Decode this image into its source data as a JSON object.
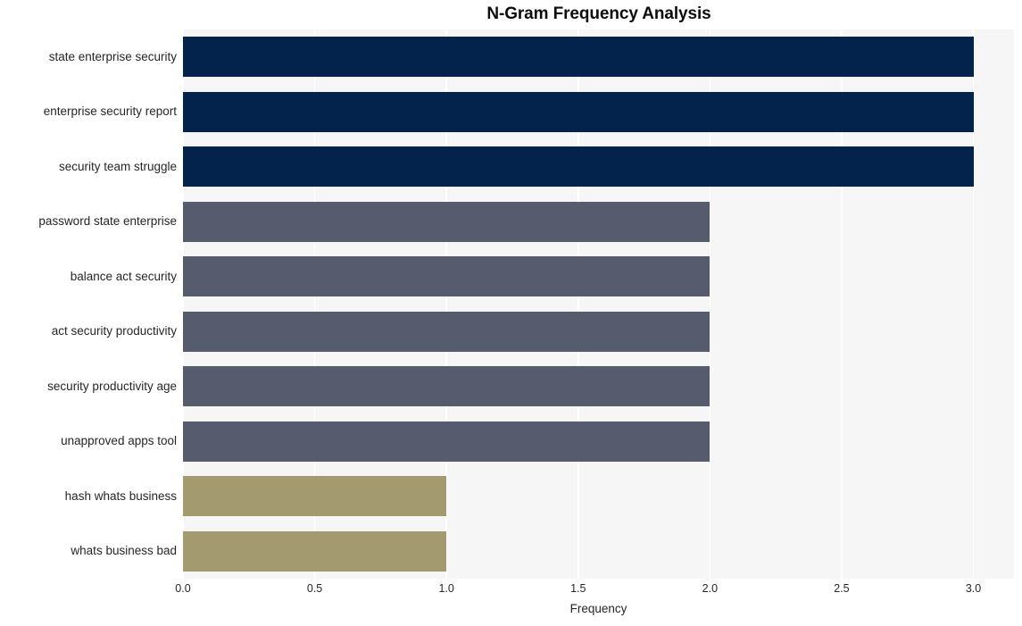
{
  "chart_data": {
    "type": "bar",
    "orientation": "horizontal",
    "title": "N-Gram Frequency Analysis",
    "xlabel": "Frequency",
    "ylabel": "",
    "categories": [
      "state enterprise security",
      "enterprise security report",
      "security team struggle",
      "password state enterprise",
      "balance act security",
      "act security productivity",
      "security productivity age",
      "unapproved apps tool",
      "hash whats business",
      "whats business bad"
    ],
    "values": [
      3,
      3,
      3,
      2,
      2,
      2,
      2,
      2,
      1,
      1
    ],
    "bar_colors": [
      "#03224c",
      "#03224c",
      "#03224c",
      "#565c6e",
      "#565c6e",
      "#565c6e",
      "#565c6e",
      "#565c6e",
      "#a49a70",
      "#a49a70"
    ],
    "xlim": [
      0.0,
      3.154
    ],
    "xticks": [
      0.0,
      0.5,
      1.0,
      1.5,
      2.0,
      2.5,
      3.0
    ],
    "xtick_labels": [
      "0.0",
      "0.5",
      "1.0",
      "1.5",
      "2.0",
      "2.5",
      "3.0"
    ],
    "grid": true,
    "grid_axis": "x",
    "grid_color": "#ffffff",
    "plot_background": "#f6f6f7",
    "figure_background": "#ffffff",
    "legend": null,
    "title_color": "#0d0d0d",
    "tick_label_color": "#262626"
  }
}
